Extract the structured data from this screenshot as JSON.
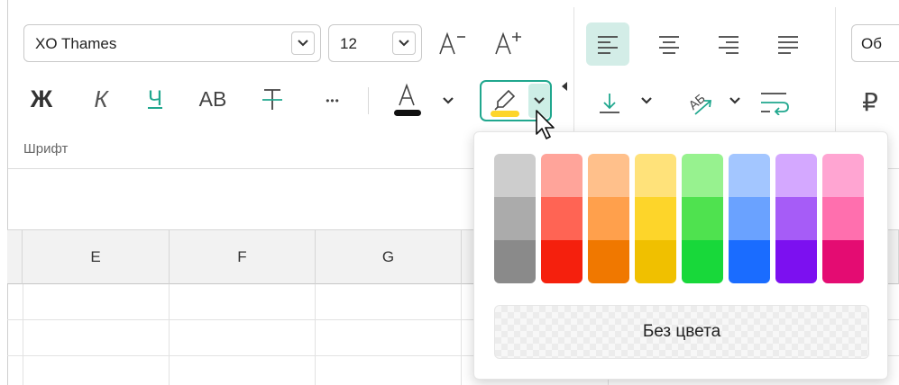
{
  "font": {
    "name": "XO Thames",
    "size": "12"
  },
  "format_buttons": {
    "bold": "Ж",
    "italic": "К",
    "underline": "Ч",
    "case": "АВ",
    "more": "•••"
  },
  "group_label": "Шрифт",
  "right_edge": {
    "number_format_partial": "Об",
    "currency": "₽"
  },
  "columns": [
    "E",
    "F",
    "G"
  ],
  "palette": {
    "columns": [
      [
        "#cdcdcd",
        "#ababab",
        "#8a8a8a"
      ],
      [
        "#ffa49a",
        "#ff6454",
        "#f5200d"
      ],
      [
        "#ffc08b",
        "#ffa04c",
        "#f07800"
      ],
      [
        "#ffe27a",
        "#fdd52a",
        "#f0c000"
      ],
      [
        "#97f28f",
        "#4fe24f",
        "#18d83a"
      ],
      [
        "#a3c6ff",
        "#6aa2ff",
        "#1a6cff"
      ],
      [
        "#d4a8ff",
        "#a65cf7",
        "#7c10f0"
      ],
      [
        "#ffa5d2",
        "#ff6fae",
        "#e40c72"
      ]
    ],
    "no_color_label": "Без цвета"
  },
  "colors": {
    "accent": "#20a78e",
    "highlight": "#fdd52a",
    "font_color_bar": "#111111"
  },
  "icons": [
    "font-decrease-icon",
    "font-increase-icon",
    "highlighter-icon",
    "chevron-down-icon",
    "align-left-icon",
    "align-center-icon",
    "align-right-icon",
    "align-justify-icon",
    "valign-bottom-icon",
    "text-rotate-icon",
    "wrap-text-icon",
    "mouse-pointer-icon"
  ]
}
